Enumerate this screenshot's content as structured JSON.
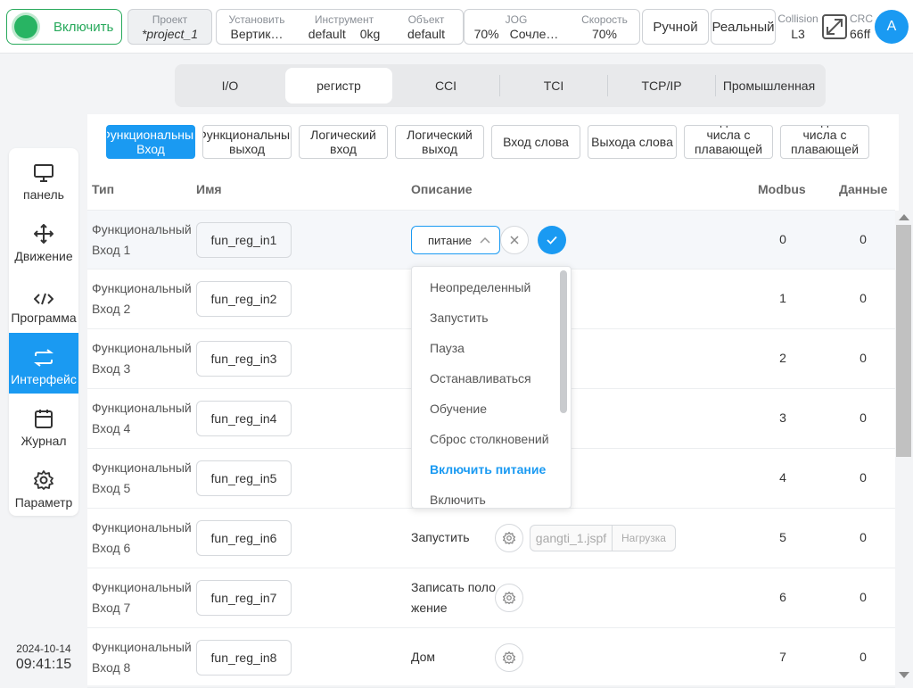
{
  "topbar": {
    "enable_label": "Включить",
    "project_key": "Проект",
    "project_value": "*project_1",
    "install_key": "Установить",
    "install_value": "Вертик…",
    "tool_key": "Инструмент",
    "tool_value": "default",
    "tool_load": "0kg",
    "object_key": "Объект",
    "object_value": "default",
    "jog_key": "JOG",
    "jog_value": "70%",
    "joint_value": "Сочле…",
    "speed_key": "Скорость",
    "speed_value": "70%",
    "mode_label": "Ручной",
    "real_label": "Реальный",
    "collision_key": "Collision",
    "collision_value": "L3",
    "crc_key": "CRC",
    "crc_value": "66ff",
    "avatar_letter": "A"
  },
  "sidebar": {
    "items": [
      {
        "label": "панель",
        "icon": "monitor-icon"
      },
      {
        "label": "Движение",
        "icon": "move-icon"
      },
      {
        "label": "Программа",
        "icon": "code-icon"
      },
      {
        "label": "Интерфейс",
        "icon": "swap-icon"
      },
      {
        "label": "Журнал",
        "icon": "calendar-icon"
      },
      {
        "label": "Параметр",
        "icon": "gear-icon"
      }
    ],
    "active_index": 3,
    "date": "2024-10-14",
    "time": "09:41:15"
  },
  "tabs": [
    "I/O",
    "регистр",
    "CCI",
    "TCI",
    "TCP/IP",
    "Промышленная"
  ],
  "active_tab": 1,
  "subtabs": [
    "Функциональный Вход",
    "Функциональный выход",
    "Логический вход",
    "Логический выход",
    "Вход слова",
    "Выхода слова",
    "Вход типа числа с плавающей точкой",
    "Выход типа числа с плавающей точкой"
  ],
  "active_subtab": 0,
  "table": {
    "headers": {
      "type": "Тип",
      "name": "Имя",
      "description": "Описание",
      "modbus": "Modbus",
      "data": "Данные"
    },
    "rows": [
      {
        "type": "Функциональный Вход 1",
        "name": "fun_reg_in1",
        "modbus": "0",
        "data": "0"
      },
      {
        "type": "Функциональный Вход 2",
        "name": "fun_reg_in2",
        "modbus": "1",
        "data": "0"
      },
      {
        "type": "Функциональный Вход 3",
        "name": "fun_reg_in3",
        "modbus": "2",
        "data": "0"
      },
      {
        "type": "Функциональный Вход 4",
        "name": "fun_reg_in4",
        "modbus": "3",
        "data": "0"
      },
      {
        "type": "Функциональный Вход 5",
        "name": "fun_reg_in5",
        "modbus": "4",
        "data": "0"
      },
      {
        "type": "Функциональный Вход 6",
        "name": "fun_reg_in6",
        "modbus": "5",
        "data": "0",
        "description": "Запустить",
        "file": "gangti_1.jspf",
        "upload": "Нагрузка"
      },
      {
        "type": "Функциональный Вход 7",
        "name": "fun_reg_in7",
        "modbus": "6",
        "data": "0",
        "description": "Записать положение"
      },
      {
        "type": "Функциональный Вход 8",
        "name": "fun_reg_in8",
        "modbus": "7",
        "data": "0",
        "description": "Дом"
      }
    ]
  },
  "editor": {
    "selected": "питание",
    "options": [
      "Неопределенный",
      "Запустить",
      "Пауза",
      "Останавливаться",
      "Обучение",
      "Сброс столкновений",
      "Включить питание",
      "Включить"
    ],
    "highlighted_index": 6
  },
  "colors": {
    "accent": "#1a9af2",
    "enable_green": "#28b463"
  }
}
